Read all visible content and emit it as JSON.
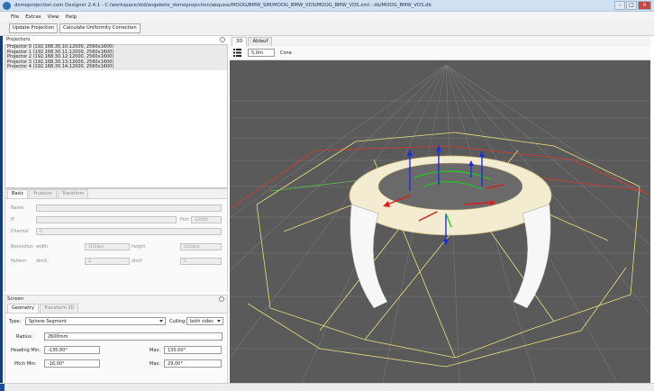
{
  "window": {
    "title": "domeprojection.com Designer 2.4.1 - C:/workspace/old/angebote_domeprojection/akquise/MOOG/BMW_SIM/MOOG_BMW_VDS/MOOG_BMW_VDS.xml : db/MOOG_BMW_VDS.db"
  },
  "menu": [
    "File",
    "Extras",
    "View",
    "Help"
  ],
  "toolbar": {
    "update_label": "Update Projection",
    "calc_label": "Calculate Uniformity Correction"
  },
  "projectors": {
    "header": "Projectors",
    "items": [
      "Projector 0 (192.168.30.10:12000, 2560x1600)",
      "Projector 1 (192.168.30.11:12000, 2560x1600)",
      "Projector 2 (192.168.30.12:12000, 2560x1600)",
      "Projector 3 (192.168.30.13:12000, 2560x1600)",
      "Projector 4 (192.168.30.14:12000, 2560x1600)"
    ]
  },
  "projector_props": {
    "tabs": [
      "Basic",
      "Frustum",
      "Transform"
    ],
    "name_label": "Name",
    "ip_label": "IP",
    "port_label": "Port",
    "port_value": "12000",
    "channel_label": "Channel",
    "channel_value": "0",
    "resolution_label": "Resolution",
    "width_label": "width",
    "width_value": "1024px",
    "height_label": "height",
    "height_value": "1024px",
    "pattern_label": "Pattern",
    "dimx_label": "dimX",
    "dimx_value": "2",
    "dimy_label": "dimY",
    "dimy_value": "2"
  },
  "screen": {
    "header": "Screen",
    "tabs": [
      "Geometry",
      "Transform 3D"
    ],
    "type_label": "Type:",
    "type_value": "Sphere Segment",
    "culling_label": "Culling:",
    "culling_value": "both sides",
    "radius_label": "Radius:",
    "radius_value": "2600mm",
    "heading_min_label": "Heading Min:",
    "heading_min_value": "-135,00°",
    "heading_max_label": "Max:",
    "heading_max_value": "135,00°",
    "pitch_min_label": "Pitch Min:",
    "pitch_min_value": "-16,00°",
    "pitch_max_label": "Max:",
    "pitch_max_value": "29,00°"
  },
  "view": {
    "tabs": [
      "3D",
      "Ablauf"
    ],
    "distance_value": "5,0m",
    "cone_label": "Cone"
  },
  "colors": {
    "viewport_bg": "#5a5a5a",
    "grid": "#7b7b7b",
    "frustum_yellow": "#e8e07a",
    "frustum_red": "#d83a2a",
    "axis_blue": "#1a2fe0",
    "axis_red": "#e01a1a",
    "axis_green": "#22cc22"
  }
}
